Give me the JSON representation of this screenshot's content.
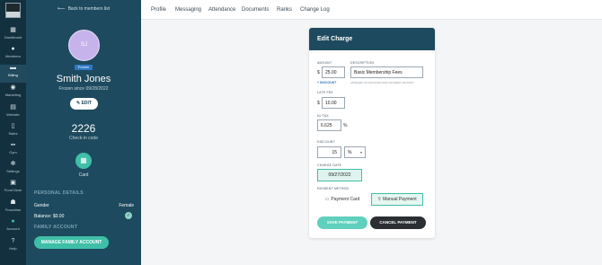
{
  "nav": {
    "items": [
      {
        "label": "Dashboard",
        "icon": "grid-icon"
      },
      {
        "label": "Members",
        "icon": "members-icon"
      },
      {
        "label": "Billing",
        "icon": "billing-icon"
      },
      {
        "label": "Marketing",
        "icon": "marketing-icon"
      },
      {
        "label": "Website",
        "icon": "website-icon"
      },
      {
        "label": "Sales",
        "icon": "sales-icon"
      },
      {
        "label": "Gym",
        "icon": "dumbbell-icon"
      },
      {
        "label": "Settings",
        "icon": "gear-icon"
      },
      {
        "label": "Front Desk",
        "icon": "front-desk-icon"
      },
      {
        "label": "Franchise",
        "icon": "franchise-icon"
      },
      {
        "label": "Account",
        "icon": "account-icon"
      },
      {
        "label": "Help",
        "icon": "help-icon"
      }
    ],
    "active": "Billing"
  },
  "profile": {
    "back_label": "Back to members list",
    "initials": "SJ",
    "status_badge": "Frozen",
    "name": "Smith Jones",
    "frozen_since": "Frozen since 09/28/2022",
    "edit_label": "EDIT",
    "checkin_code": "2226",
    "checkin_label": "Check-in code",
    "card_label": "Card",
    "personal_details_heading": "PERSONAL DETAILS",
    "gender_label": "Gender",
    "gender_value": "Female",
    "balance_label": "Balance: $0.00",
    "family_account_heading": "FAMILY ACCOUNT",
    "manage_family_label": "MANAGE FAMILY ACCOUNT"
  },
  "tabs": [
    "Profile",
    "Messaging",
    "Attendance",
    "Documents",
    "Ranks",
    "Change Log"
  ],
  "modal": {
    "title": "Edit Charge",
    "amount_label": "AMOUNT",
    "amount_currency": "$",
    "amount_value": "25.00",
    "add_discount_label": "+ DISCOUNT",
    "description_label": "DESCRIPTION",
    "description_value": "Basic Membership Fees",
    "description_hint": "APPEARS ON INVOICES AND PAYMENT HISTORY",
    "late_fee_label": "LATE FEE",
    "late_fee_currency": "$",
    "late_fee_value": "10.00",
    "nj_tax_label": "NJ TAX",
    "nj_tax_value": "6.625",
    "nj_tax_unit": "%",
    "discount_label": "DISCOUNT",
    "discount_value": "15",
    "discount_type": "%",
    "charge_date_label": "CHARGE DATE",
    "charge_date_value": "09/27/2022",
    "payment_method_label": "PAYMENT METHOD",
    "payment_card_label": "Payment Card",
    "manual_payment_label": "Manual Payment",
    "selected_payment_method": "Manual Payment",
    "save_label": "SAVE PAYMENT",
    "cancel_label": "CANCEL PAYMENT"
  },
  "colors": {
    "rail": "#13303f",
    "panel": "#1d4a5e",
    "accent": "#3fbfa7",
    "badge": "#2f78c4"
  }
}
